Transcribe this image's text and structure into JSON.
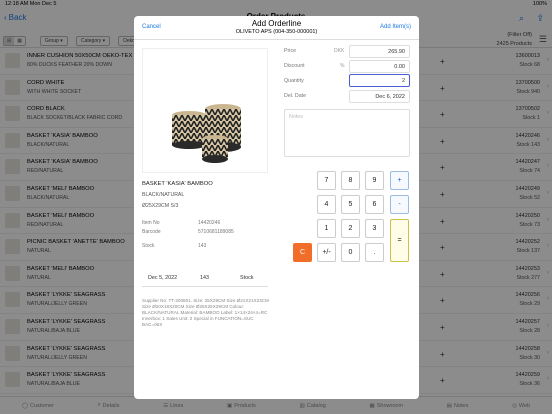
{
  "status": {
    "time": "12:18 AM",
    "date": "Mon Dec 5",
    "battery": "100%"
  },
  "nav": {
    "back_label": "Back",
    "title": "Order Products"
  },
  "filterbar": {
    "toggle_a": "⊞",
    "toggle_b": "▦",
    "chips": [
      "Group",
      "Category",
      "Oeko-Tex"
    ],
    "filter_label": "(Filter Off)",
    "products_count": "2425 Products"
  },
  "products": [
    {
      "name": "INNER CUSHION 50X50CM OEKO-TEX",
      "sub": "80% DUCKS FEATHER 20% DOWN",
      "code": "13600013",
      "stock": "Stock 68"
    },
    {
      "name": "CORD WHITE",
      "sub": "WITH WHITE SOCKET",
      "code": "13700500",
      "stock": "Stock 940"
    },
    {
      "name": "CORD BLACK",
      "sub": "BLACK SOCKET/BLACK FABRIC CORD",
      "code": "13700502",
      "stock": "Stock 1"
    },
    {
      "name": "BASKET 'KASIA' BAMBOO",
      "sub": "BLACK/NATURAL",
      "code": "14420246",
      "stock": "Stock 143"
    },
    {
      "name": "BASKET 'KASIA' BAMBOO",
      "sub": "RED/NATURAL",
      "code": "14420247",
      "stock": "Stock 74"
    },
    {
      "name": "BASKET 'MELI' BAMBOO",
      "sub": "BLACK/NATURAL",
      "code": "14420249",
      "stock": "Stock 52"
    },
    {
      "name": "BASKET 'MELI' BAMBOO",
      "sub": "RED/NATURAL",
      "code": "14420250",
      "stock": "Stock 73"
    },
    {
      "name": "PICNIC BASKET 'ANETTE' BAMBOO",
      "sub": "NATURAL",
      "code": "14420252",
      "stock": "Stock 137"
    },
    {
      "name": "BASKET 'MELI' BAMBOO",
      "sub": "NATURAL",
      "code": "14420253",
      "stock": "Stock 277"
    },
    {
      "name": "BASKET 'LYKKE' SEAGRASS",
      "sub": "NATURAL/JELLY GREEN",
      "code": "14420256",
      "stock": "Stock 29"
    },
    {
      "name": "BASKET 'LYKKE' SEAGRASS",
      "sub": "NATURAL/BAJA BLUE",
      "code": "14420257",
      "stock": "Stock 28"
    },
    {
      "name": "BASKET 'LYKKE' SEAGRASS",
      "sub": "NATURAL/JELLY GREEN",
      "code": "14420258",
      "stock": "Stock 30"
    },
    {
      "name": "BASKET 'LYKKE' SEAGRASS",
      "sub": "NATURAL/BAJA BLUE",
      "code": "14420259",
      "stock": "Stock 36"
    }
  ],
  "tabs": [
    "Customer",
    "Details",
    "Lines",
    "Products",
    "Catalog",
    "Showroom",
    "Notes",
    "Web"
  ],
  "modal": {
    "cancel": "Cancel",
    "title": "Add Orderline",
    "subtitle": "OLIVETO APS (004-350-000001)",
    "add_items": "Add Item(s)",
    "product": {
      "name": "BASKET 'KASIA' BAMBOO",
      "color": "BLACK/NATURAL",
      "size": "Ø25X29CM  S/3",
      "item_no_label": "Item No",
      "item_no": "14420246",
      "barcode_label": "Barcode",
      "barcode": "5710681189085",
      "stock_label": "Stock",
      "stock": "143",
      "avail_date": "Dec 5, 2022",
      "avail_qty": "143",
      "avail_label": "Stock",
      "description": "Supplier No: TT-200801. Size: 25X29CM Size Ø21X21X23CM Size Ø20X18X20CM Size Ø25X25X29CM Colour: BLACK/NATURAL Material: BAMBOO Label: 1×14×24×4=RC Innerbox: 1 Sales Unit: 2 Special in FUNCATION=SUC BAC=06X"
    },
    "fields": {
      "price_label": "Price",
      "price_unit": "DKK",
      "price": "265.90",
      "discount_label": "Discount",
      "discount_unit": "%",
      "discount": "0.00",
      "quantity_label": "Quantity",
      "quantity": "2",
      "del_date_label": "Del. Date",
      "del_date": "Dec 6, 2022",
      "notes_placeholder": "Notes"
    },
    "keypad": [
      "7",
      "8",
      "9",
      "+",
      "4",
      "5",
      "6",
      "-",
      "1",
      "2",
      "3",
      "C",
      "+/-",
      "0",
      ".",
      "="
    ]
  },
  "colors": {
    "accent": "#1a7ae3",
    "clear_key": "#f26d2a",
    "active_field": "#4a5ed8"
  }
}
